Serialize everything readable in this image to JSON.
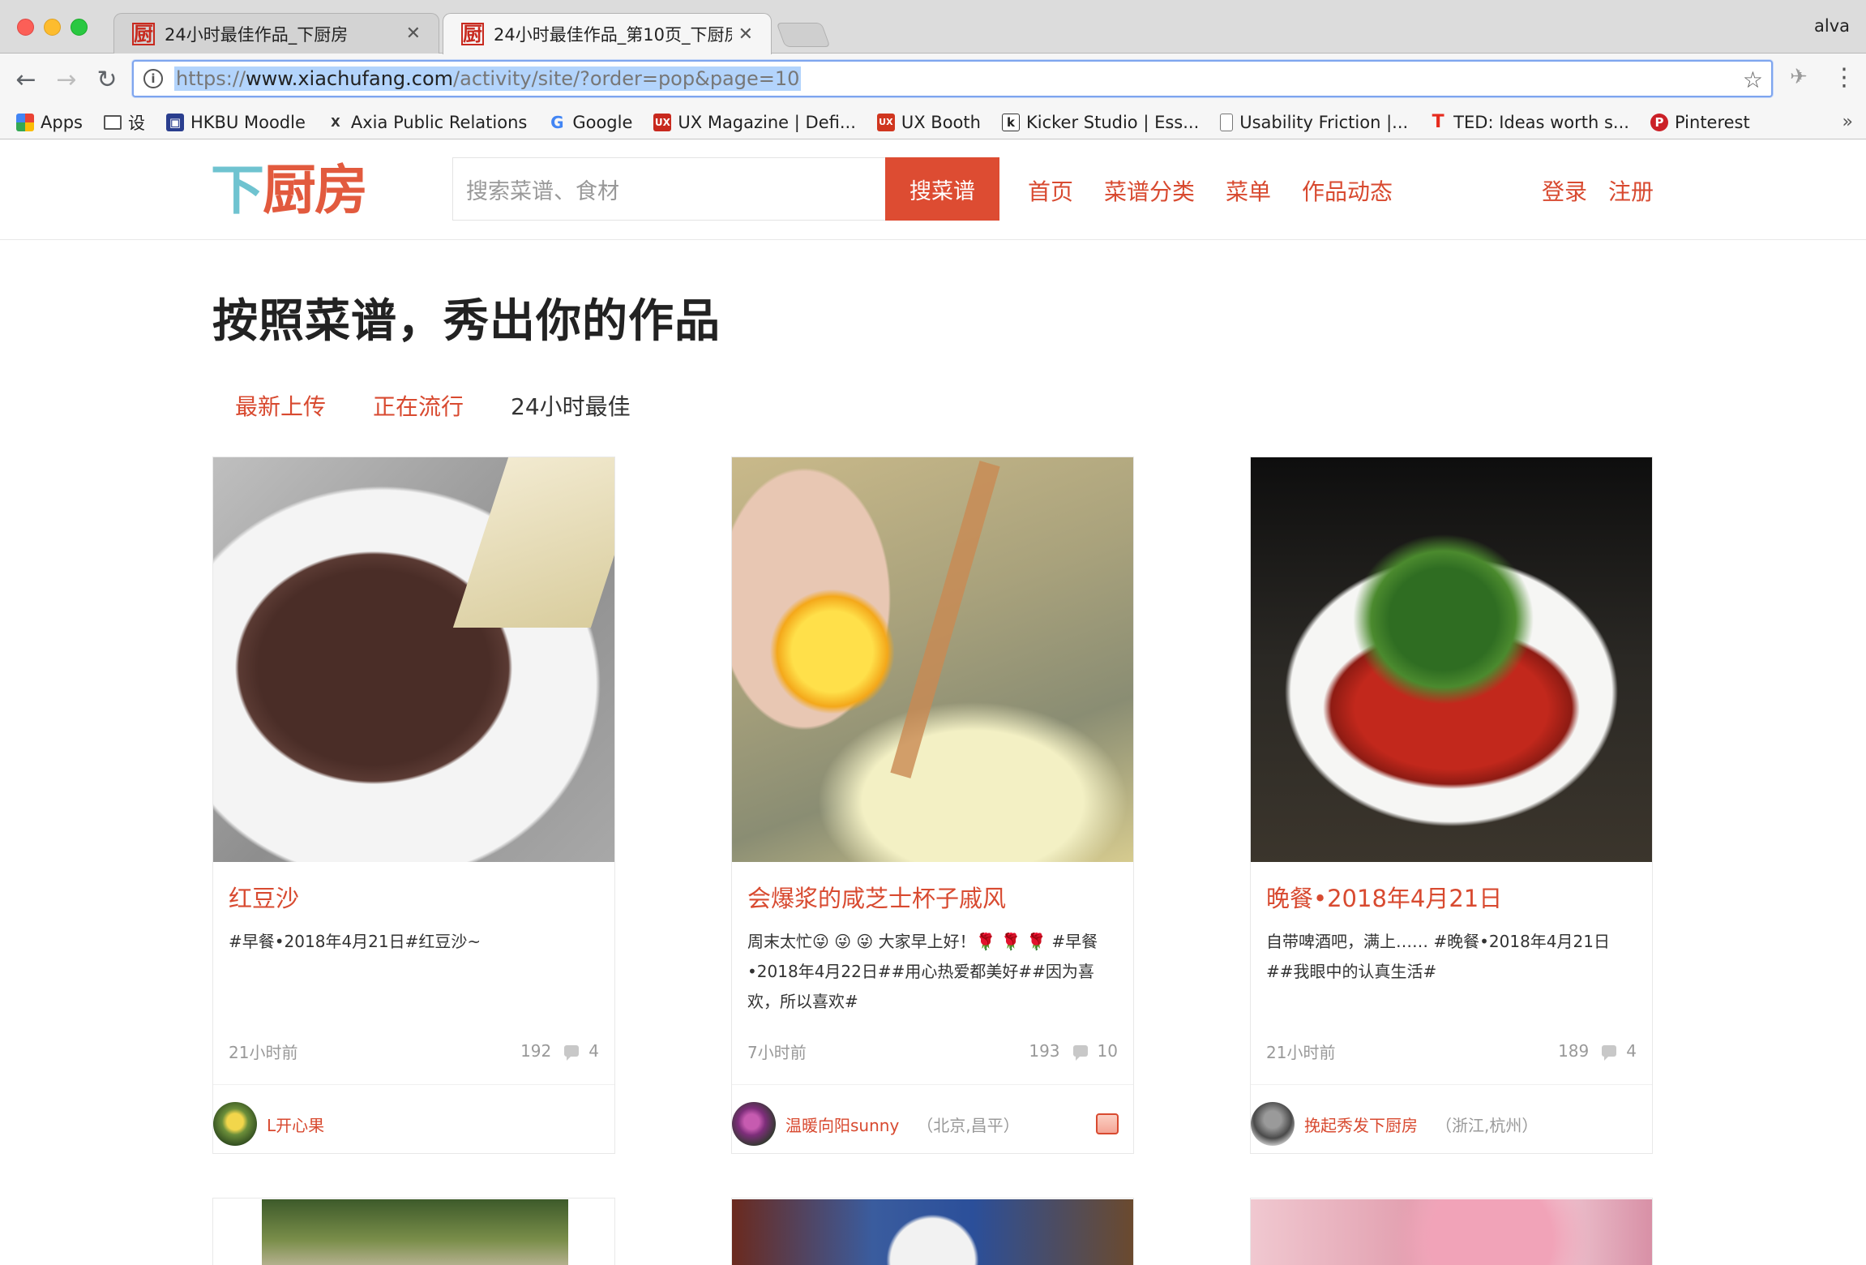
{
  "browser": {
    "tabs": [
      {
        "title": "24小时最佳作品_下厨房",
        "favicon": "厨",
        "active": false
      },
      {
        "title": "24小时最佳作品_第10页_下厨房",
        "favicon": "厨",
        "active": true
      }
    ],
    "user": "alva",
    "url": {
      "scheme": "https://",
      "host": "www.xiachufang.com",
      "path": "/activity/site/?order=pop&page=10"
    },
    "bookmarks": [
      {
        "label": "Apps",
        "icon": "apps-grid-icon"
      },
      {
        "label": "设",
        "icon": "folder-icon"
      },
      {
        "label": "HKBU Moodle",
        "icon": "moodle-icon"
      },
      {
        "label": "Axia Public Relations",
        "icon": "axia-icon"
      },
      {
        "label": "Google",
        "icon": "google-icon"
      },
      {
        "label": "UX Magazine | Defi...",
        "icon": "uxmag-icon"
      },
      {
        "label": "UX Booth",
        "icon": "uxbooth-icon"
      },
      {
        "label": "Kicker Studio | Ess...",
        "icon": "kicker-icon"
      },
      {
        "label": "Usability Friction |...",
        "icon": "page-icon"
      },
      {
        "label": "TED: Ideas worth s...",
        "icon": "ted-icon"
      },
      {
        "label": "Pinterest",
        "icon": "pinterest-icon"
      }
    ],
    "bookmarks_more": "»"
  },
  "site": {
    "logo": {
      "part1": "下",
      "part2": "厨房"
    },
    "search": {
      "placeholder": "搜索菜谱、食材",
      "button": "搜菜谱"
    },
    "nav": [
      "首页",
      "菜谱分类",
      "菜单",
      "作品动态"
    ],
    "auth": {
      "login": "登录",
      "register": "注册"
    }
  },
  "page": {
    "title": "按照菜谱，秀出你的作品",
    "filters": [
      {
        "label": "最新上传",
        "current": false
      },
      {
        "label": "正在流行",
        "current": false
      },
      {
        "label": "24小时最佳",
        "current": true
      }
    ]
  },
  "cards": [
    {
      "title": "红豆沙",
      "desc": "#早餐•2018年4月21日#红豆沙~",
      "time": "21小时前",
      "likes": "192",
      "comments": "4",
      "author": "L开心果",
      "location": "",
      "image": "red-bean-paste-photo"
    },
    {
      "title": "会爆浆的咸芝士杯子戚风",
      "desc": "周末太忙😜 😜 😜  大家早上好！🌹 🌹 🌹  #早餐•2018年4月22日##用心热爱都美好##因为喜欢，所以喜欢#",
      "time": "7小时前",
      "likes": "193",
      "comments": "10",
      "author": "温暖向阳sunny",
      "location": "（北京,昌平）",
      "image": "egg-yolk-photo"
    },
    {
      "title": "晚餐•2018年4月21日",
      "desc": "自带啤酒吧，满上…… #晚餐•2018年4月21日##我眼中的认真生活#",
      "time": "21小时前",
      "likes": "189",
      "comments": "4",
      "author": "挽起秀发下厨房",
      "location": "（浙江,杭州）",
      "image": "crayfish-photo"
    }
  ],
  "colors": {
    "accent": "#d84a30",
    "search_button": "#dd4c32",
    "logo_blue": "#6fc3d0"
  }
}
